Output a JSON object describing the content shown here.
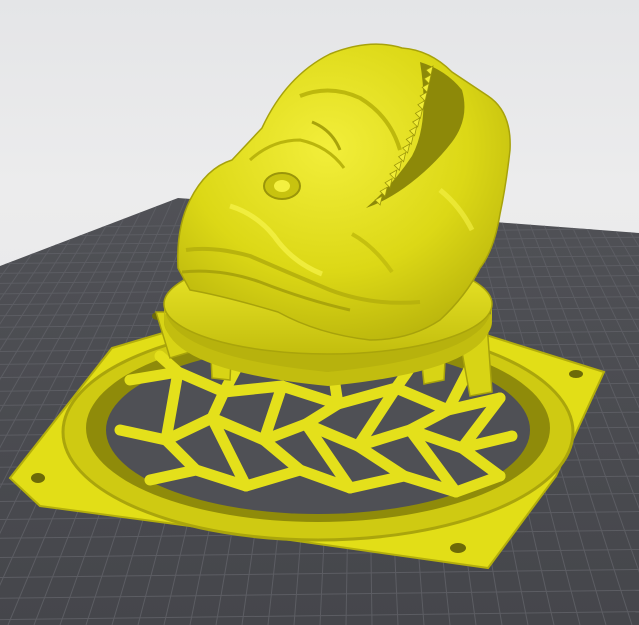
{
  "viewport": {
    "background_color": "#e8e8ea",
    "bed_color": "#4a4b50",
    "grid_color": "#5c5d63",
    "model_color": "#e6e41a",
    "model_shade_color": "#a9a40c"
  },
  "scene": {
    "model_name": "",
    "objects": [
      "build-plate",
      "fan-grill-base",
      "creature-head"
    ]
  }
}
